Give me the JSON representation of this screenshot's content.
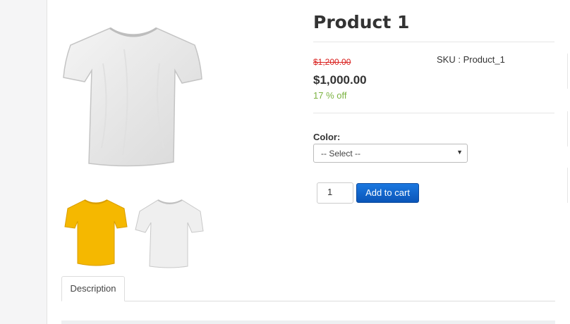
{
  "product": {
    "title": "Product 1",
    "old_price": "$1,200.00",
    "price": "$1,000.00",
    "discount": "17 % off",
    "sku": "SKU : Product_1"
  },
  "options": {
    "color_label": "Color:",
    "color_selected": "-- Select --"
  },
  "cart": {
    "quantity": "1",
    "add_label": "Add to cart"
  },
  "tabs": [
    {
      "label": "Description"
    }
  ],
  "colors": {
    "old_price": "#d9211f",
    "discount": "#7cb342",
    "button": "#0a55b8",
    "thumb_yellow": "#f5b800"
  }
}
